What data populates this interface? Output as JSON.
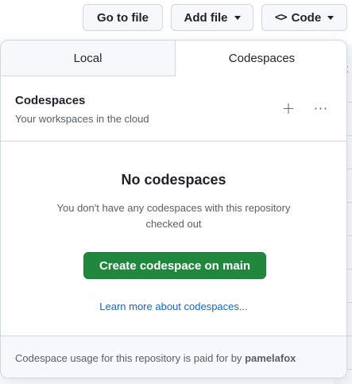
{
  "toolbar": {
    "goto_file_label": "Go to file",
    "add_file_label": "Add file",
    "code_label": "Code",
    "code_icon_glyph": "<>"
  },
  "background": {
    "partial_text": "t"
  },
  "panel": {
    "tabs": [
      {
        "label": "Local",
        "active": false
      },
      {
        "label": "Codespaces",
        "active": true
      }
    ],
    "header": {
      "title": "Codespaces",
      "subtitle": "Your workspaces in the cloud",
      "add_icon": "plus-icon",
      "more_icon": "kebab-horizontal-icon"
    },
    "empty_state": {
      "title": "No codespaces",
      "description": "You don't have any codespaces with this repository checked out",
      "create_button_label": "Create codespace on main",
      "learn_more_link": "Learn more about codespaces..."
    },
    "footer": {
      "text": "Codespace usage for this repository is paid for by",
      "user": "pamelafox"
    }
  },
  "colors": {
    "primary_green": "#1f883d",
    "link_blue": "#0969da",
    "border": "#d0d7de",
    "muted_text": "#57606a",
    "subtle_bg": "#f6f8fa"
  }
}
